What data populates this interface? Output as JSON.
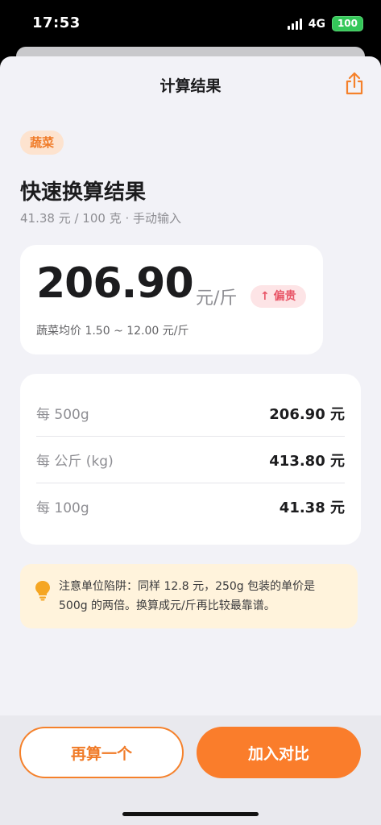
{
  "status_bar": {
    "time": "17:53",
    "network": "4G",
    "battery": "100"
  },
  "nav": {
    "title": "计算结果",
    "share_icon": "share-icon"
  },
  "category": {
    "tag": "蔬菜"
  },
  "header": {
    "title": "快速换算结果",
    "subtitle": "41.38 元 / 100 克 · 手动输入"
  },
  "result": {
    "value": "206.90",
    "unit": "元/斤",
    "badge_arrow": "↑",
    "badge_label": "偏贵",
    "range_text": "蔬菜均价 1.50 ~ 12.00 元/斤"
  },
  "units": [
    {
      "label": "每 500g",
      "value": "206.90 元"
    },
    {
      "label": "每 公斤 (kg)",
      "value": "413.80 元"
    },
    {
      "label": "每 100g",
      "value": "41.38 元"
    }
  ],
  "tip": {
    "icon": "lightbulb-icon",
    "text": "注意单位陷阱：同样 12.8 元，250g 包装的单价是 500g 的两倍。换算成元/斤再比较最靠谱。"
  },
  "actions": {
    "again_label": "再算一个",
    "compare_label": "加入对比"
  },
  "colors": {
    "accent": "#fa7d2b",
    "badge_red": "#e85567",
    "tip_bg": "#fff3dc"
  }
}
